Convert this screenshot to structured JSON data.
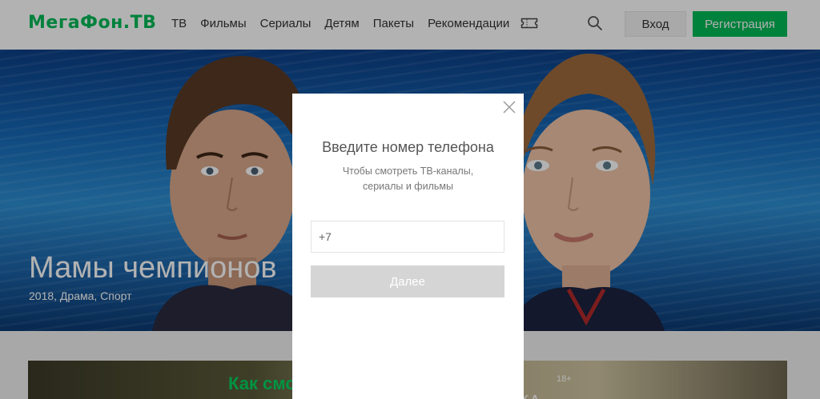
{
  "header": {
    "logo": "МегаФон.ТВ",
    "nav": [
      "ТВ",
      "Фильмы",
      "Сериалы",
      "Детям",
      "Пакеты",
      "Рекомендации"
    ],
    "login_label": "Вход",
    "register_label": "Регистрация"
  },
  "hero": {
    "title": "Мамы чемпионов",
    "meta": "2018, Драма, Спорт"
  },
  "promo": {
    "title": "Как смотреть",
    "age": "18+",
    "brand": "AMEDIATEKA"
  },
  "modal": {
    "title": "Введите номер телефона",
    "subtitle_line1": "Чтобы смотреть ТВ-каналы,",
    "subtitle_line2": "сериалы и фильмы",
    "phone_value": "+7",
    "next_label": "Далее"
  },
  "colors": {
    "brand": "#00b956",
    "overlay": "rgba(0,0,0,0.30)",
    "disabled_button": "#d5d5d5"
  },
  "icons": {
    "ticket": "ticket-icon",
    "search": "search-icon",
    "close": "close-icon"
  }
}
